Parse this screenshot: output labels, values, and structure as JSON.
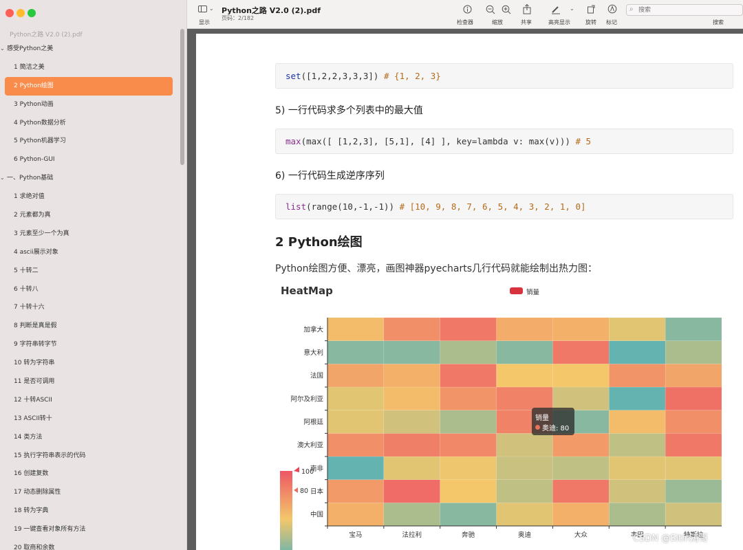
{
  "sidebar": {
    "title": "Python之路 V2.0 (2).pdf",
    "items": [
      {
        "label": "感受Python之美",
        "level": 0,
        "chevron": "⌄"
      },
      {
        "label": "1 簡洁之美",
        "level": 1
      },
      {
        "label": "2 Python绘图",
        "level": 1,
        "selected": true
      },
      {
        "label": "3 Python动画",
        "level": 1
      },
      {
        "label": "4 Python数据分析",
        "level": 1
      },
      {
        "label": "5 Python机器学习",
        "level": 1
      },
      {
        "label": "6 Python-GUI",
        "level": 1
      },
      {
        "label": "一、Python基础",
        "level": 0,
        "chevron": "⌄"
      },
      {
        "label": "1 求绝对值",
        "level": 1
      },
      {
        "label": "2 元素都为真",
        "level": 1
      },
      {
        "label": "3 元素至少一个为真",
        "level": 1
      },
      {
        "label": "4 ascii展示对象",
        "level": 1
      },
      {
        "label": "5  十转二",
        "level": 1
      },
      {
        "label": "6 十转八",
        "level": 1
      },
      {
        "label": "7 十转十六",
        "level": 1
      },
      {
        "label": "8 判断是真是假",
        "level": 1
      },
      {
        "label": "9  字符串转字节",
        "level": 1
      },
      {
        "label": "10 转为字符串",
        "level": 1
      },
      {
        "label": "11 是否可调用",
        "level": 1
      },
      {
        "label": "12 十转ASCII",
        "level": 1
      },
      {
        "label": "13 ASCII转十",
        "level": 1
      },
      {
        "label": "14 类方法",
        "level": 1
      },
      {
        "label": "15 执行字符串表示的代码",
        "level": 1
      },
      {
        "label": "16  创建复数",
        "level": 1
      },
      {
        "label": "17 动态删除属性",
        "level": 1
      },
      {
        "label": "18 转为字典",
        "level": 1
      },
      {
        "label": "19 一键查看对象所有方法",
        "level": 1
      },
      {
        "label": "20 取商和余数",
        "level": 1
      }
    ]
  },
  "toolbar": {
    "sidebar_toggle_label": "显示",
    "doc_title": "Python之路 V2.0 (2).pdf",
    "page_info": "页码：2/182",
    "inspector_label": "检查器",
    "zoom_label": "缩放",
    "share_label": "共享",
    "highlight_label": "高亮显示",
    "rotate_label": "旋转",
    "markup_label": "标记",
    "search_placeholder": "搜索",
    "search_label": "搜索"
  },
  "document": {
    "code1": {
      "fn": "set",
      "args": "([1,2,2,3,3,3])",
      "comment": "# {1, 2, 3}"
    },
    "heading5": "5) 一行代码求多个列表中的最大值",
    "code2": {
      "fn": "max",
      "rest": "(max([ [1,2,3], [5,1], [4] ], key=lambda v: max(v)))",
      "comment": "# 5"
    },
    "heading6": "6) 一行代码生成逆序序列",
    "code3": {
      "fn": "list",
      "rest": "(range(10,-1,-1))",
      "comment": "# [10, 9, 8, 7, 6, 5, 4, 3, 2, 1, 0]"
    },
    "section_heading": "2 Python绘图",
    "intro": "Python绘图方便、漂亮，画图神器pyecharts几行代码就能绘制出热力图："
  },
  "chart_data": {
    "type": "heatmap",
    "title": "HeatMap",
    "legend": [
      "销量"
    ],
    "x_categories": [
      "宝马",
      "法拉利",
      "奔驰",
      "奥迪",
      "大众",
      "丰田",
      "特斯拉"
    ],
    "y_categories": [
      "中国",
      "日本",
      "南非",
      "澳大利亚",
      "阿根廷",
      "阿尔及利亚",
      "法国",
      "意大利",
      "加拿大"
    ],
    "visual_map": {
      "max": 100,
      "pointer": 80,
      "labels": [
        "100",
        "80"
      ],
      "colors": [
        "#40aec2",
        "#f4c76a",
        "#ee5665"
      ]
    },
    "values": [
      [
        60,
        30,
        20,
        45,
        60,
        30,
        40
      ],
      [
        70,
        90,
        50,
        35,
        85,
        40,
        25
      ],
      [
        10,
        45,
        48,
        38,
        35,
        45,
        45
      ],
      [
        75,
        82,
        78,
        40,
        70,
        35,
        85
      ],
      [
        45,
        40,
        30,
        80,
        20,
        55,
        75
      ],
      [
        45,
        55,
        72,
        80,
        40,
        10,
        88
      ],
      [
        65,
        60,
        85,
        50,
        50,
        72,
        65
      ],
      [
        20,
        20,
        30,
        20,
        85,
        10,
        30
      ],
      [
        55,
        75,
        85,
        62,
        60,
        45,
        20
      ]
    ],
    "tooltip": {
      "series": "销量",
      "category": "奥迪",
      "value": 80
    }
  },
  "watermark": "CSDN @Sitin涛哥"
}
